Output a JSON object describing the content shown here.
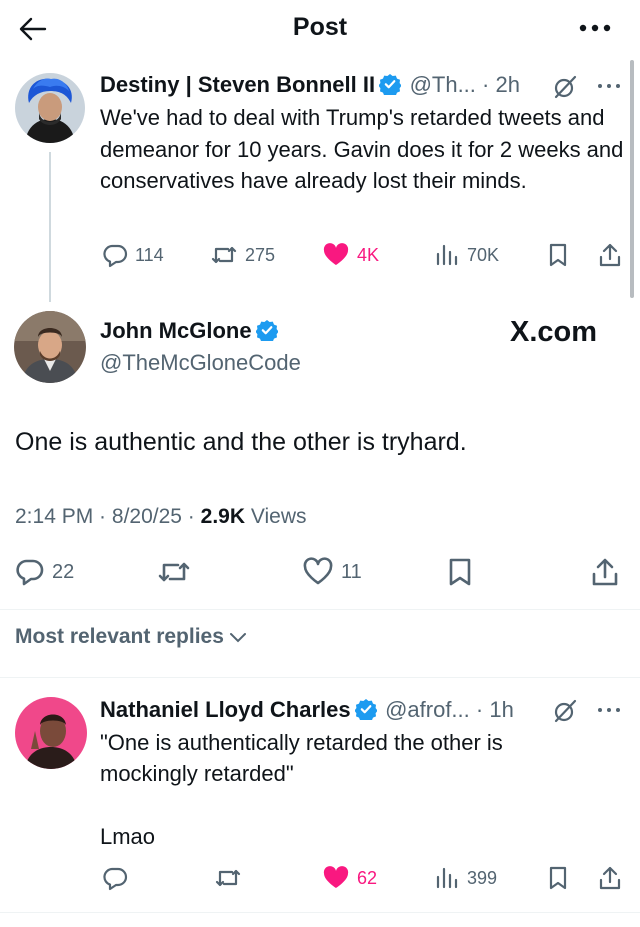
{
  "header": {
    "title": "Post"
  },
  "parent_tweet": {
    "author_name": "Destiny | Steven Bonnell II",
    "handle": "@Th...",
    "time": "2h",
    "text": "We've had to deal with Trump's retarded tweets and demeanor for 10 years. Gavin does it for 2 weeks and conservatives have already lost their minds.",
    "replies": "114",
    "reposts": "275",
    "likes": "4K",
    "views": "70K"
  },
  "main_tweet": {
    "author_name": "John McGlone",
    "handle": "@TheMcGloneCode",
    "watermark": "X.com",
    "text": "One is authentic and the other is tryhard.",
    "time": "2:14 PM",
    "date": "8/20/25",
    "view_count": "2.9K",
    "views_label": "Views",
    "replies": "22",
    "likes": "11"
  },
  "replies_filter": {
    "label": "Most relevant replies"
  },
  "reply_tweet": {
    "author_name": "Nathaniel Lloyd Charles",
    "handle": "@afrof...",
    "time": "1h",
    "text_line1": "\"One is authentically retarded the other is",
    "text_line2": "mockingly retarded\"",
    "text_line3": "Lmao",
    "likes": "62",
    "views": "399"
  },
  "colors": {
    "like_active": "#f91880",
    "verified": "#1d9bf0",
    "secondary_text": "#536471"
  }
}
